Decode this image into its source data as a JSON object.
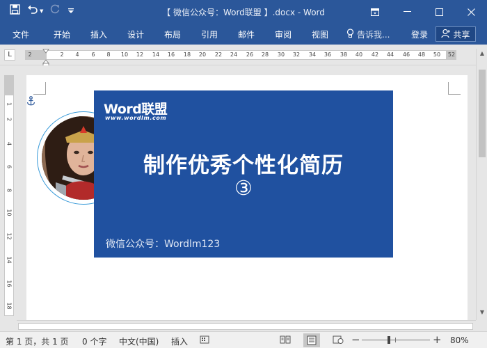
{
  "window": {
    "title": "【 微信公众号：Word联盟 】.docx - Word"
  },
  "quick_access": {
    "icons": [
      "save-icon",
      "undo-icon",
      "redo-icon",
      "customize-icon"
    ]
  },
  "ribbon": {
    "tabs": [
      "文件",
      "开始",
      "插入",
      "设计",
      "布局",
      "引用",
      "邮件",
      "审阅",
      "视图"
    ],
    "tell_me": "告诉我...",
    "login": "登录",
    "share": "共享"
  },
  "ruler": {
    "tab_selector": "L",
    "numbers": [
      "2",
      "2",
      "4",
      "6",
      "8",
      "10",
      "12",
      "14",
      "16",
      "18",
      "20",
      "22",
      "24",
      "26",
      "28",
      "30",
      "32",
      "34",
      "36",
      "38",
      "40",
      "42",
      "44",
      "46",
      "48",
      "50",
      "52"
    ],
    "vertical_numbers": [
      "1",
      "2",
      "4",
      "6",
      "8",
      "10",
      "12",
      "14",
      "16",
      "18"
    ]
  },
  "document": {
    "banner": {
      "brand": "Word联盟",
      "brand_url": "www.wordlm.com",
      "title": "制作优秀个性化简历",
      "number": "③",
      "footer": "微信公众号：Wordlm123"
    }
  },
  "status_bar": {
    "page": "第 1 页，共 1 页",
    "words": "0 个字",
    "language": "中文(中国)",
    "mode": "插入",
    "zoom": "80%"
  },
  "colors": {
    "title_bar": "#2b579a",
    "banner": "#2051a0",
    "photo_ring": "#3a9bd9"
  }
}
